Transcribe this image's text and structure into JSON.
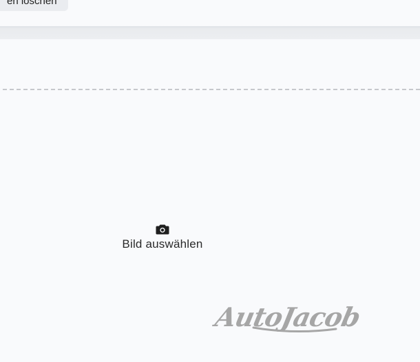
{
  "top": {
    "button_label": "en löschen"
  },
  "upload": {
    "icon": "camera-icon",
    "label": "Bild auswählen"
  },
  "logo": {
    "text": "AutoJacob",
    "color": "#a6a6a6"
  },
  "colors": {
    "background": "#f9fafc",
    "band": "#e9ebee",
    "divider": "#c6c8cc",
    "text": "#2a2a2a"
  }
}
